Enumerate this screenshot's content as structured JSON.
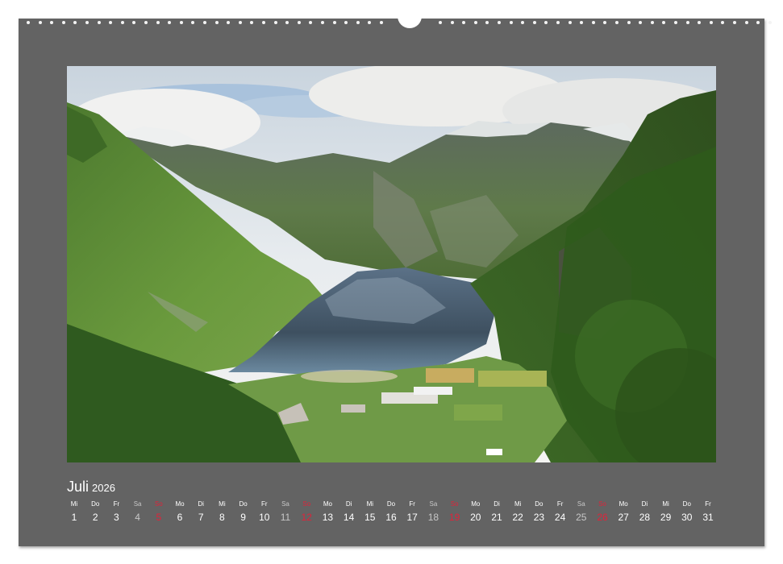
{
  "calendar": {
    "month": "Juli",
    "year": "2026",
    "days": [
      {
        "dow": "Mi",
        "num": "1",
        "type": "weekday"
      },
      {
        "dow": "Do",
        "num": "2",
        "type": "weekday"
      },
      {
        "dow": "Fr",
        "num": "3",
        "type": "weekday"
      },
      {
        "dow": "Sa",
        "num": "4",
        "type": "sat"
      },
      {
        "dow": "So",
        "num": "5",
        "type": "sun"
      },
      {
        "dow": "Mo",
        "num": "6",
        "type": "weekday"
      },
      {
        "dow": "Di",
        "num": "7",
        "type": "weekday"
      },
      {
        "dow": "Mi",
        "num": "8",
        "type": "weekday"
      },
      {
        "dow": "Do",
        "num": "9",
        "type": "weekday"
      },
      {
        "dow": "Fr",
        "num": "10",
        "type": "weekday"
      },
      {
        "dow": "Sa",
        "num": "11",
        "type": "sat"
      },
      {
        "dow": "So",
        "num": "12",
        "type": "sun"
      },
      {
        "dow": "Mo",
        "num": "13",
        "type": "weekday"
      },
      {
        "dow": "Di",
        "num": "14",
        "type": "weekday"
      },
      {
        "dow": "Mi",
        "num": "15",
        "type": "weekday"
      },
      {
        "dow": "Do",
        "num": "16",
        "type": "weekday"
      },
      {
        "dow": "Fr",
        "num": "17",
        "type": "weekday"
      },
      {
        "dow": "Sa",
        "num": "18",
        "type": "sat"
      },
      {
        "dow": "So",
        "num": "19",
        "type": "sun"
      },
      {
        "dow": "Mo",
        "num": "20",
        "type": "weekday"
      },
      {
        "dow": "Di",
        "num": "21",
        "type": "weekday"
      },
      {
        "dow": "Mi",
        "num": "22",
        "type": "weekday"
      },
      {
        "dow": "Do",
        "num": "23",
        "type": "weekday"
      },
      {
        "dow": "Fr",
        "num": "24",
        "type": "weekday"
      },
      {
        "dow": "Sa",
        "num": "25",
        "type": "sat"
      },
      {
        "dow": "So",
        "num": "26",
        "type": "sun"
      },
      {
        "dow": "Mo",
        "num": "27",
        "type": "weekday"
      },
      {
        "dow": "Di",
        "num": "28",
        "type": "weekday"
      },
      {
        "dow": "Mi",
        "num": "29",
        "type": "weekday"
      },
      {
        "dow": "Do",
        "num": "30",
        "type": "weekday"
      },
      {
        "dow": "Fr",
        "num": "31",
        "type": "weekday"
      }
    ]
  },
  "colors": {
    "page_background": "#636363",
    "weekday_text": "#ffffff",
    "saturday_text": "#c7c7c7",
    "sunday_text": "#e0233a"
  }
}
